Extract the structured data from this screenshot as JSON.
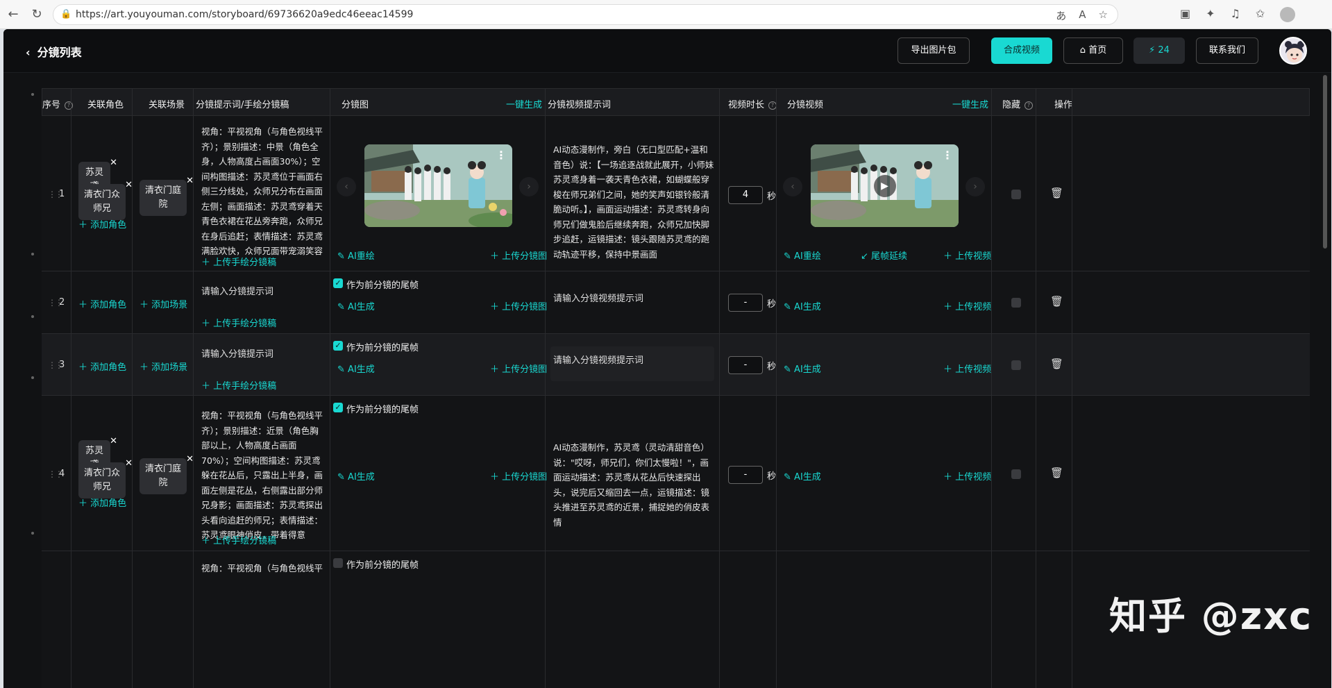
{
  "browser": {
    "url": "https://art.youyouman.com/storyboard/69736620a9edc46eeac14599"
  },
  "topbar": {
    "back_label": "分镜列表",
    "export_label": "导出图片包",
    "compose_label": "合成视频",
    "home_label": "首页",
    "points_value": "24",
    "contact_label": "联系我们"
  },
  "table": {
    "headers": {
      "index": "序号",
      "role": "关联角色",
      "scene": "关联场景",
      "prompt": "分镜提示词/手绘分镜稿",
      "image": "分镜图",
      "image_gen_all": "一键生成",
      "video_prompt": "分镜视频提示词",
      "duration": "视频时长",
      "video": "分镜视频",
      "video_gen_all": "一键生成",
      "hide": "隐藏",
      "ops": "操作"
    },
    "labels": {
      "add_role": "添加角色",
      "add_scene": "添加场景",
      "upload_sketch": "上传手绘分镜稿",
      "ai_redraw": "AI重绘",
      "ai_generate": "AI生成",
      "upload_image": "上传分镜图",
      "use_prev_frame": "作为前分镜的尾帧",
      "tail_extend": "尾帧延续",
      "upload_video": "上传视频",
      "seconds": "秒",
      "prompt_placeholder": "请输入分镜提示词",
      "video_prompt_placeholder": "请输入分镜视频提示词"
    },
    "rows": [
      {
        "index": "1",
        "roles": [
          "苏灵鸢",
          "清衣门众师兄"
        ],
        "scene": "清衣门庭院",
        "prompt": "视角：平视视角（与角色视线平齐）；景别描述：中景（角色全身，人物高度占画面30%）；空间构图描述：苏灵鸢位于画面右侧三分线处，众师兄分布在画面左侧；画面描述：苏灵鸢穿着天青色衣裙在花丛旁奔跑，众师兄在身后追赶；表情描述：苏灵鸢满脸欢快，众师兄面带宠溺笑容",
        "video_prompt": "AI动态漫制作，旁白（无口型匹配+温和音色）说：【一场追逐战就此展开，小师妹苏灵鸢身着一袭天青色衣裙，如蝴蝶般穿梭在师兄弟们之间，她的笑声如银铃般清脆动听。】，画面运动描述：苏灵鸢转身向师兄们做鬼脸后继续奔跑，众师兄加快脚步追赶，运镜描述：镜头跟随苏灵鸢的跑动轨迹平移，保持中景画面",
        "duration": "4"
      },
      {
        "index": "2",
        "duration": "-"
      },
      {
        "index": "3",
        "duration": "-"
      },
      {
        "index": "4",
        "roles": [
          "苏灵鸢",
          "清衣门众师兄"
        ],
        "scene": "清衣门庭院",
        "prompt": "视角：平视视角（与角色视线平齐）；景别描述：近景（角色胸部以上，人物高度占画面70%）；空间构图描述：苏灵鸢躲在花丛后，只露出上半身，画面左侧是花丛，右侧露出部分师兄身影；画面描述：苏灵鸢探出头看向追赶的师兄；表情描述：苏灵鸢眼神俏皮，带着得意",
        "video_prompt": "AI动态漫制作，苏灵鸢（灵动清甜音色）说：\"哎呀，师兄们，你们太慢啦！\"，画面运动描述：苏灵鸢从花丛后快速探出头，说完后又缩回去一点，运镜描述：镜头推进至苏灵鸢的近景，捕捉她的俏皮表情",
        "duration": "-"
      },
      {
        "index": "",
        "prompt": "视角：平视视角（与角色视线平"
      }
    ]
  },
  "watermark": "知乎 @zxc",
  "colors": {
    "accent": "#19d9d2",
    "background": "#111214"
  }
}
